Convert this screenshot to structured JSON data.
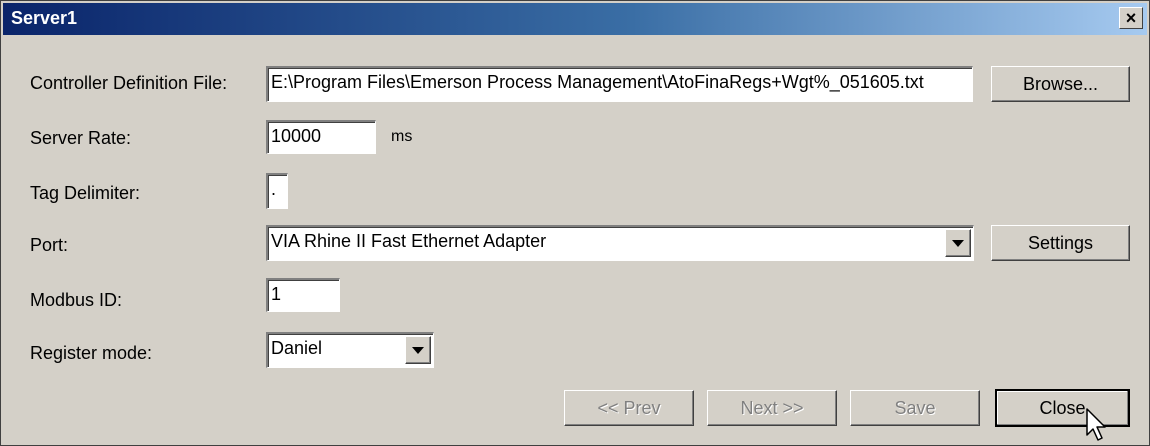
{
  "window": {
    "title": "Server1",
    "close_glyph": "×"
  },
  "form": {
    "controller_definition_file": {
      "label": "Controller Definition File:",
      "value": "E:\\Program Files\\Emerson Process Management\\AtoFinaRegs+Wgt%_051605.txt"
    },
    "server_rate": {
      "label": "Server Rate:",
      "value": "10000",
      "unit": "ms"
    },
    "tag_delimiter": {
      "label": "Tag Delimiter:",
      "value": "."
    },
    "port": {
      "label": "Port:",
      "value": "VIA Rhine II Fast Ethernet Adapter"
    },
    "modbus_id": {
      "label": "Modbus ID:",
      "value": "1"
    },
    "register_mode": {
      "label": "Register mode:",
      "value": "Daniel"
    }
  },
  "buttons": {
    "browse": "Browse...",
    "settings": "Settings",
    "prev": "<< Prev",
    "next": "Next >>",
    "save": "Save",
    "close": "Close"
  },
  "icons": {
    "dropdown": "chevron-down-icon",
    "close": "close-icon",
    "cursor": "mouse-pointer-icon"
  }
}
